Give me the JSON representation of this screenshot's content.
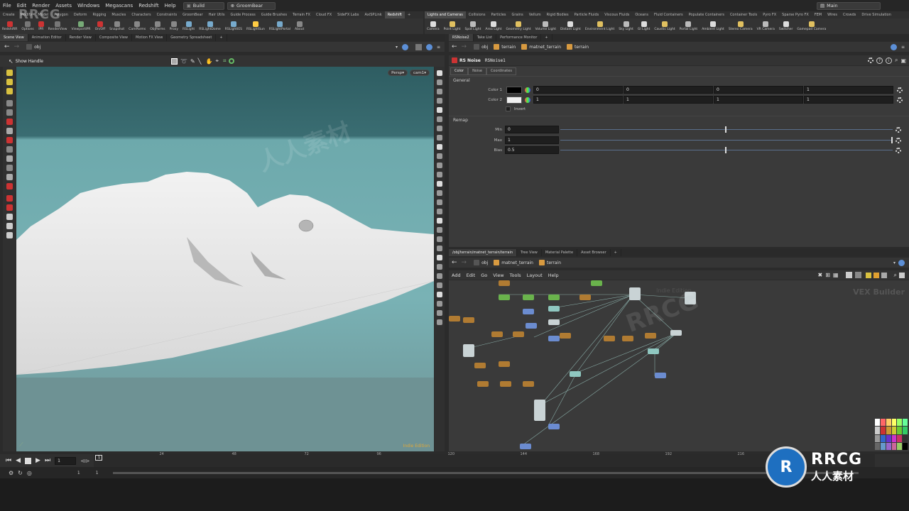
{
  "menu": [
    "File",
    "Edit",
    "Render",
    "Assets",
    "Windows",
    "Megascans",
    "Redshift",
    "Help"
  ],
  "desktop": "Build",
  "scene": "GroomBear",
  "workspace": "Main",
  "shelf_tabs_left": [
    "Create",
    "Modify",
    "Model",
    "Polygon",
    "Deform",
    "Rigging",
    "Muscles",
    "Characters",
    "Constraints",
    "GroomBear",
    "Hair Utils",
    "Guide Process",
    "Guide Brushes",
    "Terrain FX",
    "Cloud FX",
    "SideFX Labs",
    "AxiSPLink",
    "Redshift"
  ],
  "shelf_tools_left": [
    "RedshiftR",
    "Options",
    "IPR",
    "RenderView",
    "ViewportIPR",
    "On/Off",
    "Snapshot",
    "CamParms",
    "ObjParms",
    "Proxy",
    "RSLight",
    "RSLightDome",
    "RSLightIES",
    "RSLightSun",
    "RSLightPortal",
    "About"
  ],
  "shelf_tabs_right": [
    "Lights and Cameras",
    "Collisions",
    "Particles",
    "Grains",
    "Vellum",
    "Rigid Bodies",
    "Particle Fluids",
    "Viscous Fluids",
    "Oceans",
    "Fluid Containers",
    "Populate Containers",
    "Container Tools",
    "Pyro FX",
    "Sparse Pyro FX",
    "FEM",
    "Wires",
    "Crowds",
    "Drive Simulation"
  ],
  "shelf_tools_right": [
    "Camera",
    "Point Light",
    "Spot Light",
    "Area Light",
    "Geometry Light",
    "Volume Light",
    "Distant Light",
    "Environment Light",
    "Sky Light",
    "GI Light",
    "Caustic Light",
    "Portal Light",
    "Ambient Light",
    "Stereo Camera",
    "VR Camera",
    "Switcher",
    "Gamepad Camera"
  ],
  "left_pane": {
    "tabs": [
      "Scene View",
      "Animation Editor",
      "Render View",
      "Composite View",
      "Motion FX View",
      "Geometry Spreadsheet"
    ],
    "path": "obj",
    "show_handle": "Show Handle",
    "persp": "Persp",
    "cam": "cam1",
    "watermark": "Indie Edition"
  },
  "params_pane": {
    "tabs": [
      "RSNoise2",
      "Take List",
      "Performance Monitor"
    ],
    "crumbs": [
      "obj",
      "terrain",
      "matnet_terrain",
      "terrain"
    ],
    "node_type": "RS Noise",
    "node_name": "RSNoise1",
    "sub_tabs": [
      "Color",
      "Noise",
      "Coordinates"
    ],
    "general_label": "General",
    "color1_label": "Color 1",
    "color1_values": [
      "0",
      "0",
      "0",
      "1"
    ],
    "color2_label": "Color 2",
    "color2_values": [
      "1",
      "1",
      "1",
      "1"
    ],
    "invert_label": "Invert",
    "remap_label": "Remap",
    "min_label": "Min",
    "min_value": "0",
    "max_label": "Max",
    "max_value": "1",
    "bias_label": "Bias",
    "bias_value": "0.5",
    "min_slider": 0.5,
    "max_slider": 1.0,
    "bias_slider": 0.5
  },
  "network_pane": {
    "tabs": [
      "/obj/terrain/matnet_terrain/terrain",
      "Tree View",
      "Material Palette",
      "Asset Browser"
    ],
    "crumbs": [
      "obj",
      "matnet_terrain",
      "terrain"
    ],
    "menu": [
      "Add",
      "Edit",
      "Go",
      "View",
      "Tools",
      "Layout",
      "Help"
    ],
    "context_label": "VEX Builder",
    "watermark": "Indie Edition"
  },
  "timeline": {
    "current_frame": "1",
    "ticks_left": [
      "24",
      "48",
      "72",
      "96"
    ],
    "ticks_right": [
      "120",
      "144",
      "168",
      "192",
      "216"
    ],
    "start": "1",
    "end": "1",
    "range_start": "1"
  },
  "watermarks": {
    "rrcg": "RRCG",
    "cn": "人人素材"
  },
  "colors": {
    "viewport_sky_top": "#2e5d62",
    "viewport_sky_bottom": "#73aeb1",
    "ground": "#6e9294",
    "accent_orange": "#b07b32",
    "node_green": "#6ab34c",
    "node_blue": "#6b8cd0"
  }
}
